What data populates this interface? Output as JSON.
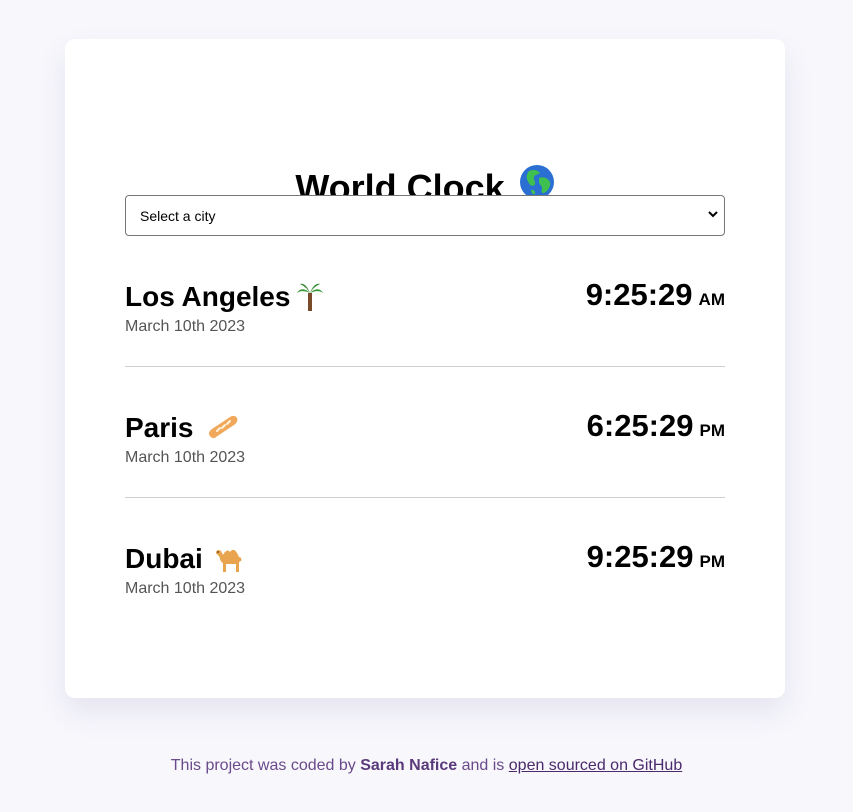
{
  "app": {
    "title": "World Clock",
    "title_icon": "globe-emoji-icon"
  },
  "city_select": {
    "selected": "Select a city"
  },
  "cities": [
    {
      "name": "Los Angeles",
      "icon": "palm-tree-icon",
      "date": "March 10th 2023",
      "time": "9:25:29",
      "ampm": "AM"
    },
    {
      "name": "Paris",
      "icon": "baguette-icon",
      "date": "March 10th 2023",
      "time": "6:25:29",
      "ampm": "PM"
    },
    {
      "name": "Dubai",
      "icon": "camel-icon",
      "date": "March 10th 2023",
      "time": "9:25:29",
      "ampm": "PM"
    }
  ],
  "footer": {
    "prefix": "This project was coded by",
    "author": "Sarah Nafice",
    "middle": "and is",
    "link_text": "open sourced on GitHub"
  },
  "colors": {
    "page_background": "#f7f7fc",
    "card_background": "#ffffff",
    "footer_text": "#6a4a8a",
    "divider": "#cfcfcf"
  }
}
